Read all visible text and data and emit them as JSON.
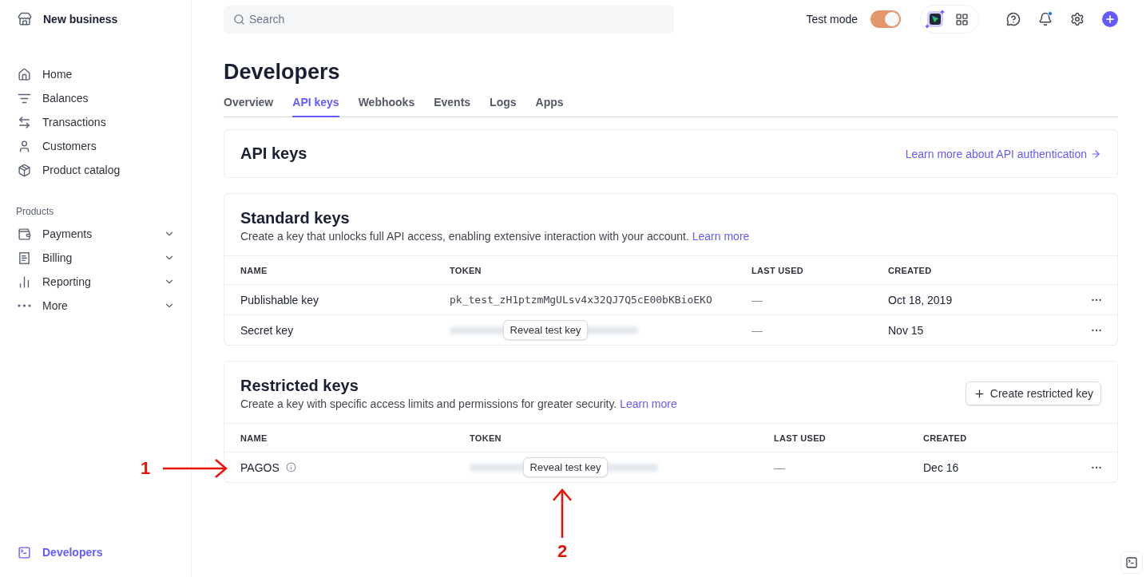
{
  "sidebar": {
    "account": "New business",
    "items": [
      {
        "label": "Home",
        "selected": false
      },
      {
        "label": "Balances",
        "selected": false
      },
      {
        "label": "Transactions",
        "selected": false
      },
      {
        "label": "Customers",
        "selected": false
      },
      {
        "label": "Product catalog",
        "selected": false
      }
    ],
    "section_title": "Products",
    "product_items": [
      {
        "label": "Payments",
        "selected": false
      },
      {
        "label": "Billing",
        "selected": false
      },
      {
        "label": "Reporting",
        "selected": false
      },
      {
        "label": "More",
        "selected": false
      }
    ],
    "footer_item": {
      "label": "Developers",
      "selected": true
    }
  },
  "topbar": {
    "search": {
      "placeholder": "Search"
    },
    "test_mode": {
      "label": "Test mode",
      "on": true
    },
    "notification_unread": true
  },
  "page": {
    "title": "Developers",
    "tabs": [
      {
        "label": "Overview",
        "selected": false
      },
      {
        "label": "API keys",
        "selected": true
      },
      {
        "label": "Webhooks",
        "selected": false
      },
      {
        "label": "Events",
        "selected": false
      },
      {
        "label": "Logs",
        "selected": false
      },
      {
        "label": "Apps",
        "selected": false
      }
    ]
  },
  "api_keys_card": {
    "title": "API keys",
    "link": "Learn more about API authentication"
  },
  "standard_keys": {
    "title": "Standard keys",
    "description": "Create a key that unlocks full API access, enabling extensive interaction with your account.",
    "link": "Learn more",
    "columns": [
      "NAME",
      "TOKEN",
      "LAST USED",
      "CREATED"
    ],
    "rows": [
      {
        "name": "Publishable key",
        "token": {
          "kind": "visible",
          "text": "pk_test_zH1ptzmMgULsv4x32QJ7Q5cE00bKBioEKO"
        },
        "last_used": "—",
        "created": "Oct 18, 2019",
        "info": false
      },
      {
        "name": "Secret key",
        "token": {
          "kind": "hidden",
          "button": "Reveal test key"
        },
        "last_used": "—",
        "created": "Nov 15",
        "info": false
      }
    ]
  },
  "restricted_keys": {
    "title": "Restricted keys",
    "description": "Create a key with specific access limits and permissions for greater security.",
    "link": "Learn more",
    "button": "Create restricted key",
    "columns": [
      "NAME",
      "TOKEN",
      "LAST USED",
      "CREATED"
    ],
    "rows": [
      {
        "name": "PAGOS",
        "token": {
          "kind": "hidden",
          "button": "Reveal test key"
        },
        "last_used": "—",
        "created": "Dec 16",
        "info": true
      }
    ]
  },
  "annotations": [
    {
      "number": "1",
      "kind": "right"
    },
    {
      "number": "2",
      "kind": "up"
    }
  ]
}
